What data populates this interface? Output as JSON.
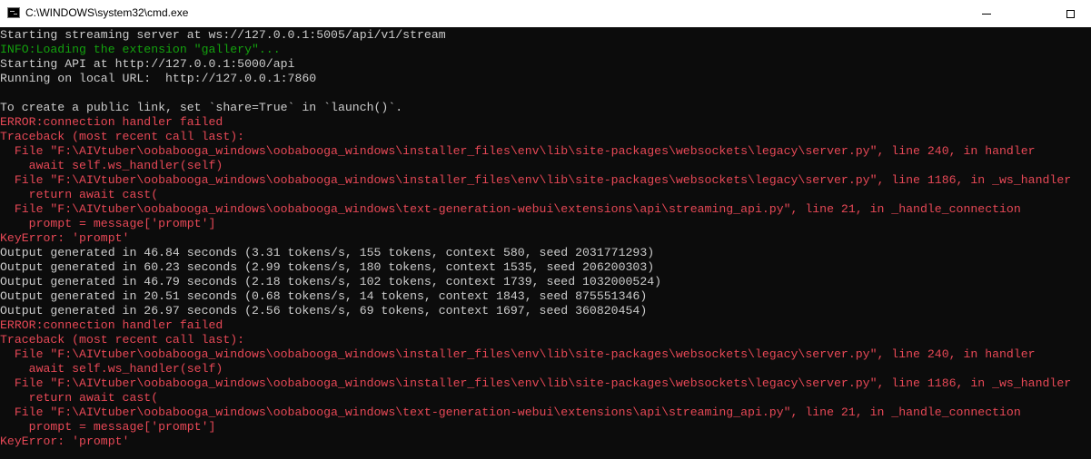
{
  "window": {
    "title": "C:\\WINDOWS\\system32\\cmd.exe",
    "icon": "cmd-icon",
    "controls": {
      "minimize_icon": "minimize-icon",
      "maximize_icon": "maximize-icon"
    }
  },
  "colors": {
    "background": "#0c0c0c",
    "default_text": "#cccccc",
    "info": "#13a10e",
    "error": "#e74856"
  },
  "console": {
    "lines": [
      {
        "text": "Starting streaming server at ws://127.0.0.1:5005/api/v1/stream",
        "color": "white"
      },
      {
        "text": "INFO:Loading the extension \"gallery\"...",
        "color": "green"
      },
      {
        "text": "Starting API at http://127.0.0.1:5000/api",
        "color": "white"
      },
      {
        "text": "Running on local URL:  http://127.0.0.1:7860",
        "color": "white"
      },
      {
        "text": "",
        "color": "white"
      },
      {
        "text": "To create a public link, set `share=True` in `launch()`.",
        "color": "white"
      },
      {
        "text": "ERROR:connection handler failed",
        "color": "red"
      },
      {
        "text": "Traceback (most recent call last):",
        "color": "red"
      },
      {
        "text": "  File \"F:\\AIVtuber\\oobabooga_windows\\oobabooga_windows\\installer_files\\env\\lib\\site-packages\\websockets\\legacy\\server.py\", line 240, in handler",
        "color": "red"
      },
      {
        "text": "    await self.ws_handler(self)",
        "color": "red"
      },
      {
        "text": "  File \"F:\\AIVtuber\\oobabooga_windows\\oobabooga_windows\\installer_files\\env\\lib\\site-packages\\websockets\\legacy\\server.py\", line 1186, in _ws_handler",
        "color": "red"
      },
      {
        "text": "    return await cast(",
        "color": "red"
      },
      {
        "text": "  File \"F:\\AIVtuber\\oobabooga_windows\\oobabooga_windows\\text-generation-webui\\extensions\\api\\streaming_api.py\", line 21, in _handle_connection",
        "color": "red"
      },
      {
        "text": "    prompt = message['prompt']",
        "color": "red"
      },
      {
        "text": "KeyError: 'prompt'",
        "color": "red"
      },
      {
        "text": "Output generated in 46.84 seconds (3.31 tokens/s, 155 tokens, context 580, seed 2031771293)",
        "color": "white"
      },
      {
        "text": "Output generated in 60.23 seconds (2.99 tokens/s, 180 tokens, context 1535, seed 206200303)",
        "color": "white"
      },
      {
        "text": "Output generated in 46.79 seconds (2.18 tokens/s, 102 tokens, context 1739, seed 1032000524)",
        "color": "white"
      },
      {
        "text": "Output generated in 20.51 seconds (0.68 tokens/s, 14 tokens, context 1843, seed 875551346)",
        "color": "white"
      },
      {
        "text": "Output generated in 26.97 seconds (2.56 tokens/s, 69 tokens, context 1697, seed 360820454)",
        "color": "white"
      },
      {
        "text": "ERROR:connection handler failed",
        "color": "red"
      },
      {
        "text": "Traceback (most recent call last):",
        "color": "red"
      },
      {
        "text": "  File \"F:\\AIVtuber\\oobabooga_windows\\oobabooga_windows\\installer_files\\env\\lib\\site-packages\\websockets\\legacy\\server.py\", line 240, in handler",
        "color": "red"
      },
      {
        "text": "    await self.ws_handler(self)",
        "color": "red"
      },
      {
        "text": "  File \"F:\\AIVtuber\\oobabooga_windows\\oobabooga_windows\\installer_files\\env\\lib\\site-packages\\websockets\\legacy\\server.py\", line 1186, in _ws_handler",
        "color": "red"
      },
      {
        "text": "    return await cast(",
        "color": "red"
      },
      {
        "text": "  File \"F:\\AIVtuber\\oobabooga_windows\\oobabooga_windows\\text-generation-webui\\extensions\\api\\streaming_api.py\", line 21, in _handle_connection",
        "color": "red"
      },
      {
        "text": "    prompt = message['prompt']",
        "color": "red"
      },
      {
        "text": "KeyError: 'prompt'",
        "color": "red"
      }
    ]
  }
}
